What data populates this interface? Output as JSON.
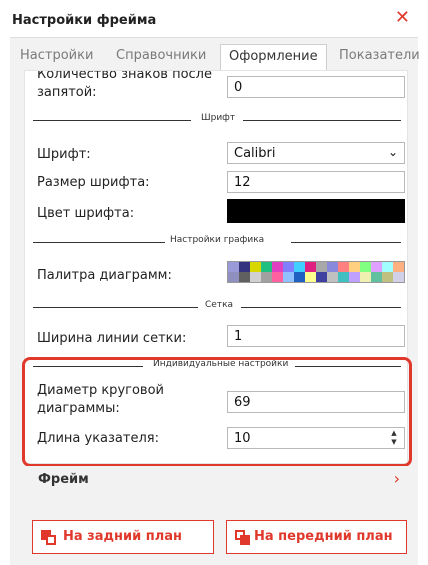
{
  "window": {
    "title": "Настройки фрейма",
    "close_glyph": "✕"
  },
  "tabs": [
    {
      "label": "Настройки",
      "active": false
    },
    {
      "label": "Справочники",
      "active": false
    },
    {
      "label": "Оформление",
      "active": true
    },
    {
      "label": "Показатели",
      "active": false
    }
  ],
  "rows": {
    "decimals": {
      "label_line1": "Количество знаков после",
      "label_line2": "запятой:",
      "value": "0"
    },
    "font": {
      "label": "Шрифт:",
      "value": "Calibri",
      "arrow": "⌄"
    },
    "font_size": {
      "label": "Размер шрифта:",
      "value": "12"
    },
    "font_color": {
      "label": "Цвет шрифта:",
      "color": "#000000"
    },
    "palette": {
      "label": "Палитра диаграмм:"
    },
    "grid_width": {
      "label": "Ширина линии сетки:",
      "value": "1"
    },
    "pie_diameter": {
      "label_line1": "Диаметр круговой",
      "label_line2": "диаграммы:",
      "value": "69"
    },
    "pointer_length": {
      "label": "Длина указателя:",
      "value": "10"
    }
  },
  "sections": {
    "font": "Шрифт",
    "chart": "Настройки графика",
    "grid": "Сетка",
    "individual": "Индивидуальные настройки"
  },
  "palette_colors": [
    "#9a9ad8",
    "#333380",
    "#d8d800",
    "#20c080",
    "#e040c0",
    "#8080ff",
    "#40d0ff",
    "#e02080",
    "#a8a8a8",
    "#8888dd",
    "#ff8080",
    "#ffd080",
    "#80ff80",
    "#e0a0ff",
    "#a0ffff",
    "#ffb080",
    "#9090c0",
    "#606060",
    "#d0d0d0",
    "#a0a0a0",
    "#ff60a0",
    "#90c0ff",
    "#2060c0",
    "#ffff90",
    "#4040a0",
    "#c0c0c0",
    "#40c0c0",
    "#c0a0ff",
    "#f0f0b0",
    "#60c0a0",
    "#c0c080",
    "#d0d0e8"
  ],
  "frame_row": {
    "label": "Фрейм",
    "chevron": "›"
  },
  "buttons": {
    "back": "На задний план",
    "front": "На передний план"
  },
  "colors": {
    "accent": "#e0392b"
  }
}
